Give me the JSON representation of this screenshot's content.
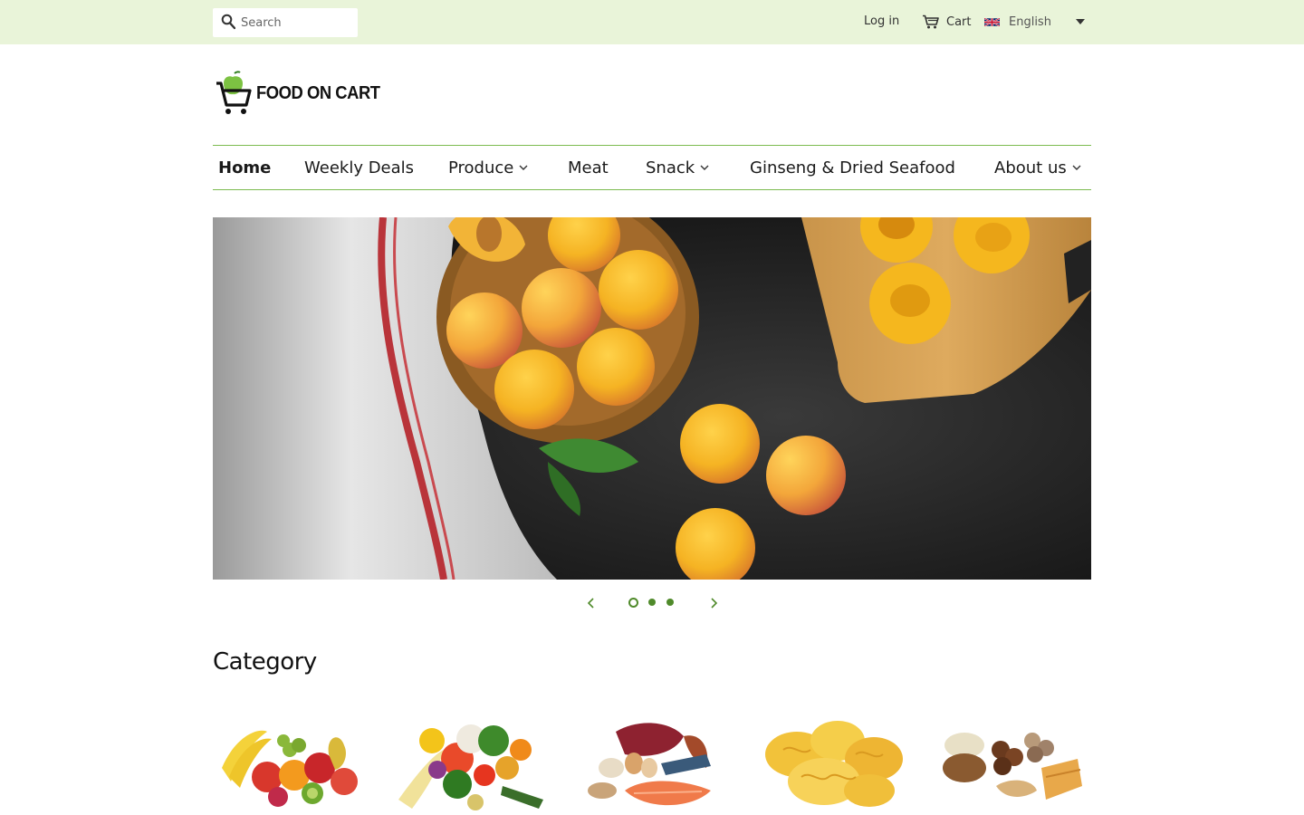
{
  "topbar": {
    "search_placeholder": "Search",
    "login_label": "Log in",
    "cart_label": "Cart",
    "language_label": "English",
    "background_color": "#e9f4d9"
  },
  "brand": {
    "logo_text": "FOOD ON CART",
    "accent_color": "#7cbb4f"
  },
  "nav": {
    "items": [
      {
        "label": "Home",
        "active": true,
        "has_dropdown": false
      },
      {
        "label": "Weekly Deals",
        "active": false,
        "has_dropdown": false
      },
      {
        "label": "Produce",
        "active": false,
        "has_dropdown": true
      },
      {
        "label": "Meat",
        "active": false,
        "has_dropdown": false
      },
      {
        "label": "Snack",
        "active": false,
        "has_dropdown": true
      },
      {
        "label": "Ginseng & Dried Seafood",
        "active": false,
        "has_dropdown": false
      },
      {
        "label": "About us",
        "active": false,
        "has_dropdown": true
      }
    ]
  },
  "slideshow": {
    "slide_count": 3,
    "current_slide": 1,
    "subject": "apricots"
  },
  "category": {
    "title": "Category",
    "items": [
      {
        "icon": "fruits-image"
      },
      {
        "icon": "vegetables-image"
      },
      {
        "icon": "meat-seafood-image"
      },
      {
        "icon": "chips-image"
      },
      {
        "icon": "dried-goods-image"
      }
    ]
  }
}
